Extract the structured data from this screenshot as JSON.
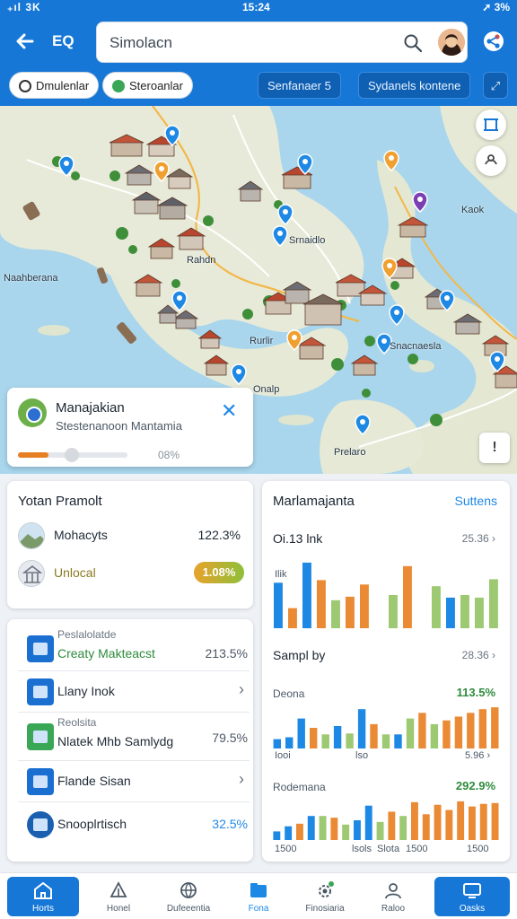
{
  "status_bar": {
    "left": "₊ıl 3K",
    "time": "15:24",
    "right": "➚ 3%"
  },
  "topbar": {
    "back_icon": "arrow-left-icon",
    "tag": "EQ",
    "search_value": "Simolacn",
    "search_icon": "search-icon",
    "share_icon": "share-icon"
  },
  "chips": [
    {
      "label": "Dmulenlar",
      "style": "light",
      "dot_color": "#ffffff"
    },
    {
      "label": "Steroanlar",
      "style": "light",
      "dot_color": "#3aa757"
    },
    {
      "label": "Senfanaer 5",
      "style": "dark"
    },
    {
      "label": "Sydanels kontene",
      "style": "dark"
    }
  ],
  "map": {
    "labels": [
      "Naahberana",
      "Kaok",
      "Srnaidlo",
      "Rahdn",
      "Rurlir",
      "Snacnaesla",
      "Onalp",
      "Prelaro"
    ],
    "fab_icons": [
      "layers-icon",
      "compass-icon"
    ]
  },
  "route_card": {
    "title": "Manajakian",
    "subtitle": "Stestenanoon Mantamia",
    "progress": 0.28,
    "percent": "08%"
  },
  "left_card": {
    "title": "Yotan Pramolt",
    "rows": [
      {
        "label": "Mohacyts",
        "value": "122.3%"
      },
      {
        "label": "Unlocal",
        "pill": "1.08%"
      }
    ]
  },
  "list_card": {
    "rows": [
      {
        "top": "Peslalolatde",
        "label": "Creaty Makteacst",
        "value": "213.5%",
        "label_color": "#2e8b3c"
      },
      {
        "label": "Llany Inok",
        "chevron": "›"
      },
      {
        "top": "Reolsita",
        "label": "Nlatek Mhb Samlydg",
        "value": "79.5%"
      },
      {
        "label": "Flande Sisan",
        "chevron": "›"
      },
      {
        "label": "Snooplrtisch",
        "value": "32.5%",
        "value_color": "#1e88e5"
      }
    ]
  },
  "stats_card": {
    "title": "Marlamajanta",
    "link": "Suttens",
    "charts": [
      {
        "head": "Oi.13 lnk",
        "meta": "25.36 ›",
        "x_labels": [
          "Ilik"
        ]
      },
      {
        "head": "Sampl by",
        "meta": "28.36 ›",
        "sub": "Deona",
        "green": "113.5%",
        "x_labels": [
          "Iooi",
          "lso",
          "5.96 ›"
        ]
      },
      {
        "sub": "Rodemana",
        "green": "292.9%",
        "x_labels": [
          "1500",
          "lsols",
          "Slota",
          "1500",
          "1500"
        ]
      }
    ]
  },
  "chart_data": [
    {
      "type": "bar",
      "series": [
        {
          "values": [
            5.2,
            2.3,
            7.5,
            5.5,
            3.2,
            3.6,
            5.0,
            0,
            3.8,
            7.1,
            0,
            4.8,
            3.5,
            3.8,
            3.5,
            5.6
          ]
        }
      ]
    },
    {
      "type": "bar",
      "series": [
        {
          "values": [
            1.0,
            1.2,
            3.2,
            2.2,
            1.5,
            2.4,
            1.6,
            4.2,
            2.6,
            1.5,
            1.5,
            3.2,
            3.8,
            2.6,
            3.0,
            3.4,
            3.8,
            4.2,
            4.4
          ]
        }
      ]
    },
    {
      "type": "bar",
      "series": [
        {
          "values": [
            1.0,
            1.6,
            1.9,
            2.8,
            2.8,
            2.6,
            1.8,
            2.3,
            4.0,
            2.1,
            3.3,
            2.8,
            4.4,
            3.0,
            4.1,
            3.5,
            4.5,
            3.9,
            4.2,
            4.3
          ]
        }
      ]
    }
  ],
  "bottom_nav": [
    {
      "label": "Horts",
      "icon": "home-icon",
      "active": true
    },
    {
      "label": "Honel",
      "icon": "hierarchy-icon"
    },
    {
      "label": "Dufeeentia",
      "icon": "globe-icon"
    },
    {
      "label": "Fona",
      "icon": "folder-icon"
    },
    {
      "label": "Finosiaria",
      "icon": "settings-icon"
    },
    {
      "label": "Raloo",
      "icon": "user-icon"
    },
    {
      "label": "Oasks",
      "icon": "tasks-icon",
      "active": true
    }
  ],
  "colors": {
    "primary": "#1677d6",
    "bar_blue": "#1e88e5",
    "bar_orange": "#ea8a35",
    "bar_green": "#9cc971",
    "positive": "#2e8b3c"
  }
}
